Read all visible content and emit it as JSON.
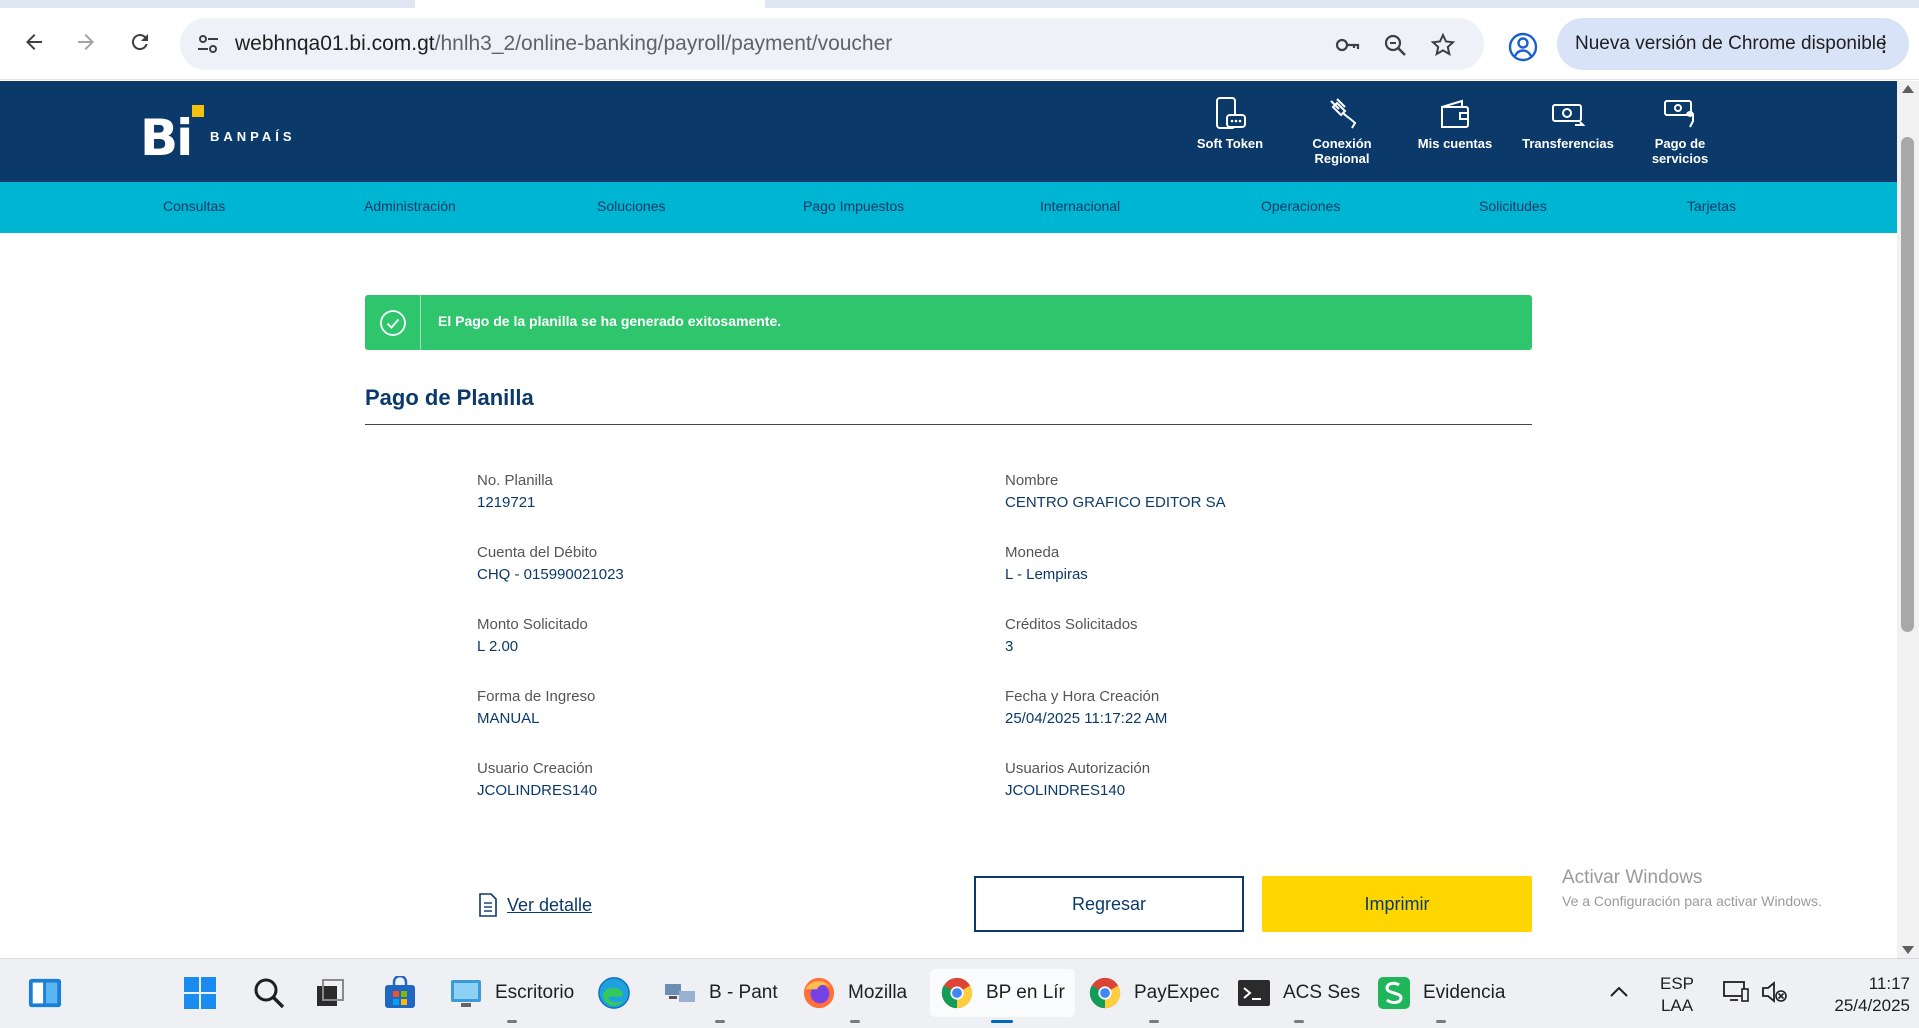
{
  "browser": {
    "url_domain": "webhnqa01.bi.com.gt",
    "url_path": "/hnlh3_2/online-banking/payroll/payment/voucher",
    "update_label": "Nueva versión de Chrome disponible"
  },
  "header": {
    "brand": "BANPAÍS",
    "logo_text": "Bi",
    "actions": [
      {
        "label": "Soft Token",
        "icon": "phone-token-icon"
      },
      {
        "label": "Conexión Regional",
        "icon": "plug-icon"
      },
      {
        "label": "Mis cuentas",
        "icon": "wallet-icon"
      },
      {
        "label": "Transferencias",
        "icon": "money-transfer-icon"
      },
      {
        "label": "Pago de servicios",
        "icon": "bill-payment-icon"
      }
    ]
  },
  "menu": {
    "items": [
      "Consultas",
      "Administración",
      "Soluciones",
      "Pago Impuestos",
      "Internacional",
      "Operaciones",
      "Solicitudes",
      "Tarjetas"
    ]
  },
  "alert": {
    "message": "El Pago de la planilla se ha generado exitosamente.",
    "color": "#2ec56d"
  },
  "voucher": {
    "title": "Pago de Planilla",
    "left": [
      {
        "label": "No. Planilla",
        "value": "1219721"
      },
      {
        "label": "Cuenta del Débito",
        "value": "CHQ - 015990021023"
      },
      {
        "label": "Monto Solicitado",
        "value": "L 2.00"
      },
      {
        "label": "Forma de Ingreso",
        "value": "MANUAL"
      },
      {
        "label": "Usuario Creación",
        "value": "JCOLINDRES140"
      }
    ],
    "right": [
      {
        "label": "Nombre",
        "value": "CENTRO GRAFICO EDITOR SA"
      },
      {
        "label": "Moneda",
        "value": "L - Lempiras"
      },
      {
        "label": "Créditos Solicitados",
        "value": "3"
      },
      {
        "label": "Fecha y Hora Creación",
        "value": "25/04/2025 11:17:22 AM"
      },
      {
        "label": "Usuarios Autorización",
        "value": "JCOLINDRES140"
      }
    ],
    "detail_link": "Ver detalle",
    "back_button": "Regresar",
    "print_button": "Imprimir"
  },
  "watermark": {
    "line1": "Activar Windows",
    "line2": "Ve a Configuración para activar Windows."
  },
  "taskbar": {
    "apps": [
      {
        "label": "Escritorio"
      },
      {
        "label": "B - Pant"
      },
      {
        "label": "Mozilla"
      },
      {
        "label": "BP en Lír"
      },
      {
        "label": "PayExpec"
      },
      {
        "label": "ACS Ses"
      },
      {
        "label": "Evidencia"
      }
    ],
    "lang_top": "ESP",
    "lang_bottom": "LAA",
    "time": "11:17",
    "date": "25/4/2025"
  },
  "colors": {
    "header_bg": "#0b3a6a",
    "menu_bg": "#00b5d1",
    "primary_text": "#0b3a6a",
    "print_button": "#ffd600"
  }
}
